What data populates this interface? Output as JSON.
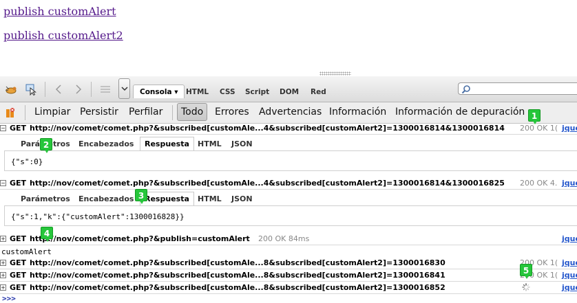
{
  "page": {
    "links": [
      "publish customAlert",
      "publish customAlert2"
    ]
  },
  "toolbar": {
    "tabs": [
      {
        "label": "Consola ▾",
        "active": true
      },
      {
        "label": "HTML"
      },
      {
        "label": "CSS"
      },
      {
        "label": "Script"
      },
      {
        "label": "DOM"
      },
      {
        "label": "Red"
      }
    ],
    "icons": [
      "firebug-icon",
      "inspect-icon",
      "back-icon",
      "forward-icon",
      "menu-icon",
      "chevron-down-icon",
      "search-icon"
    ]
  },
  "filterbar": {
    "items": [
      {
        "label": "Limpiar"
      },
      {
        "label": "Persistir"
      },
      {
        "label": "Perfilar"
      },
      {
        "label": "Todo",
        "active": true
      },
      {
        "label": "Errores"
      },
      {
        "label": "Advertencias"
      },
      {
        "label": "Información"
      },
      {
        "label": "Información de depuración"
      }
    ]
  },
  "requests": [
    {
      "toggle": "−",
      "method": "GET",
      "url": "http://nov/comet/comet.php?&subscribed[customAle...4&subscribed[customAlert2]=1300016814&1300016814",
      "status": "200 OK 1(",
      "source": "jque",
      "tabs": [
        "Parámetros",
        "Encabezados",
        "Respuesta",
        "HTML",
        "JSON"
      ],
      "active_tab": 2,
      "body": "{\"s\":0}"
    },
    {
      "toggle": "−",
      "method": "GET",
      "url": "http://nov/comet/comet.php?&subscribed[customAle...4&subscribed[customAlert2]=1300016814&1300016825",
      "status": "200 OK 4.",
      "source": "jque",
      "tabs": [
        "Parámetros",
        "Encabezados",
        "Respuesta",
        "HTML",
        "JSON"
      ],
      "active_tab": 2,
      "body": "{\"s\":1,\"k\":{\"customAlert\":1300016828}}"
    },
    {
      "toggle": "+",
      "method": "GET",
      "url": "http://nov/comet/comet.php?&publish=customAlert",
      "status": "200 OK 84ms",
      "source": "jque",
      "log": "customAlert"
    },
    {
      "toggle": "+",
      "method": "GET",
      "url": "http://nov/comet/comet.php?&subscribed[customAle...8&subscribed[customAlert2]=1300016830",
      "status": "200 OK 1(",
      "source": "jque"
    },
    {
      "toggle": "+",
      "method": "GET",
      "url": "http://nov/comet/comet.php?&subscribed[customAle...8&subscribed[customAlert2]=1300016841",
      "status": "200 OK 1(",
      "source": "jque"
    },
    {
      "toggle": "+",
      "method": "GET",
      "url": "http://nov/comet/comet.php?&subscribed[customAle...8&subscribed[customAlert2]=1300016852",
      "status": "",
      "source": "jque"
    }
  ],
  "markers": [
    "1",
    "2",
    "3",
    "4",
    "5"
  ],
  "command_line": ">>>"
}
